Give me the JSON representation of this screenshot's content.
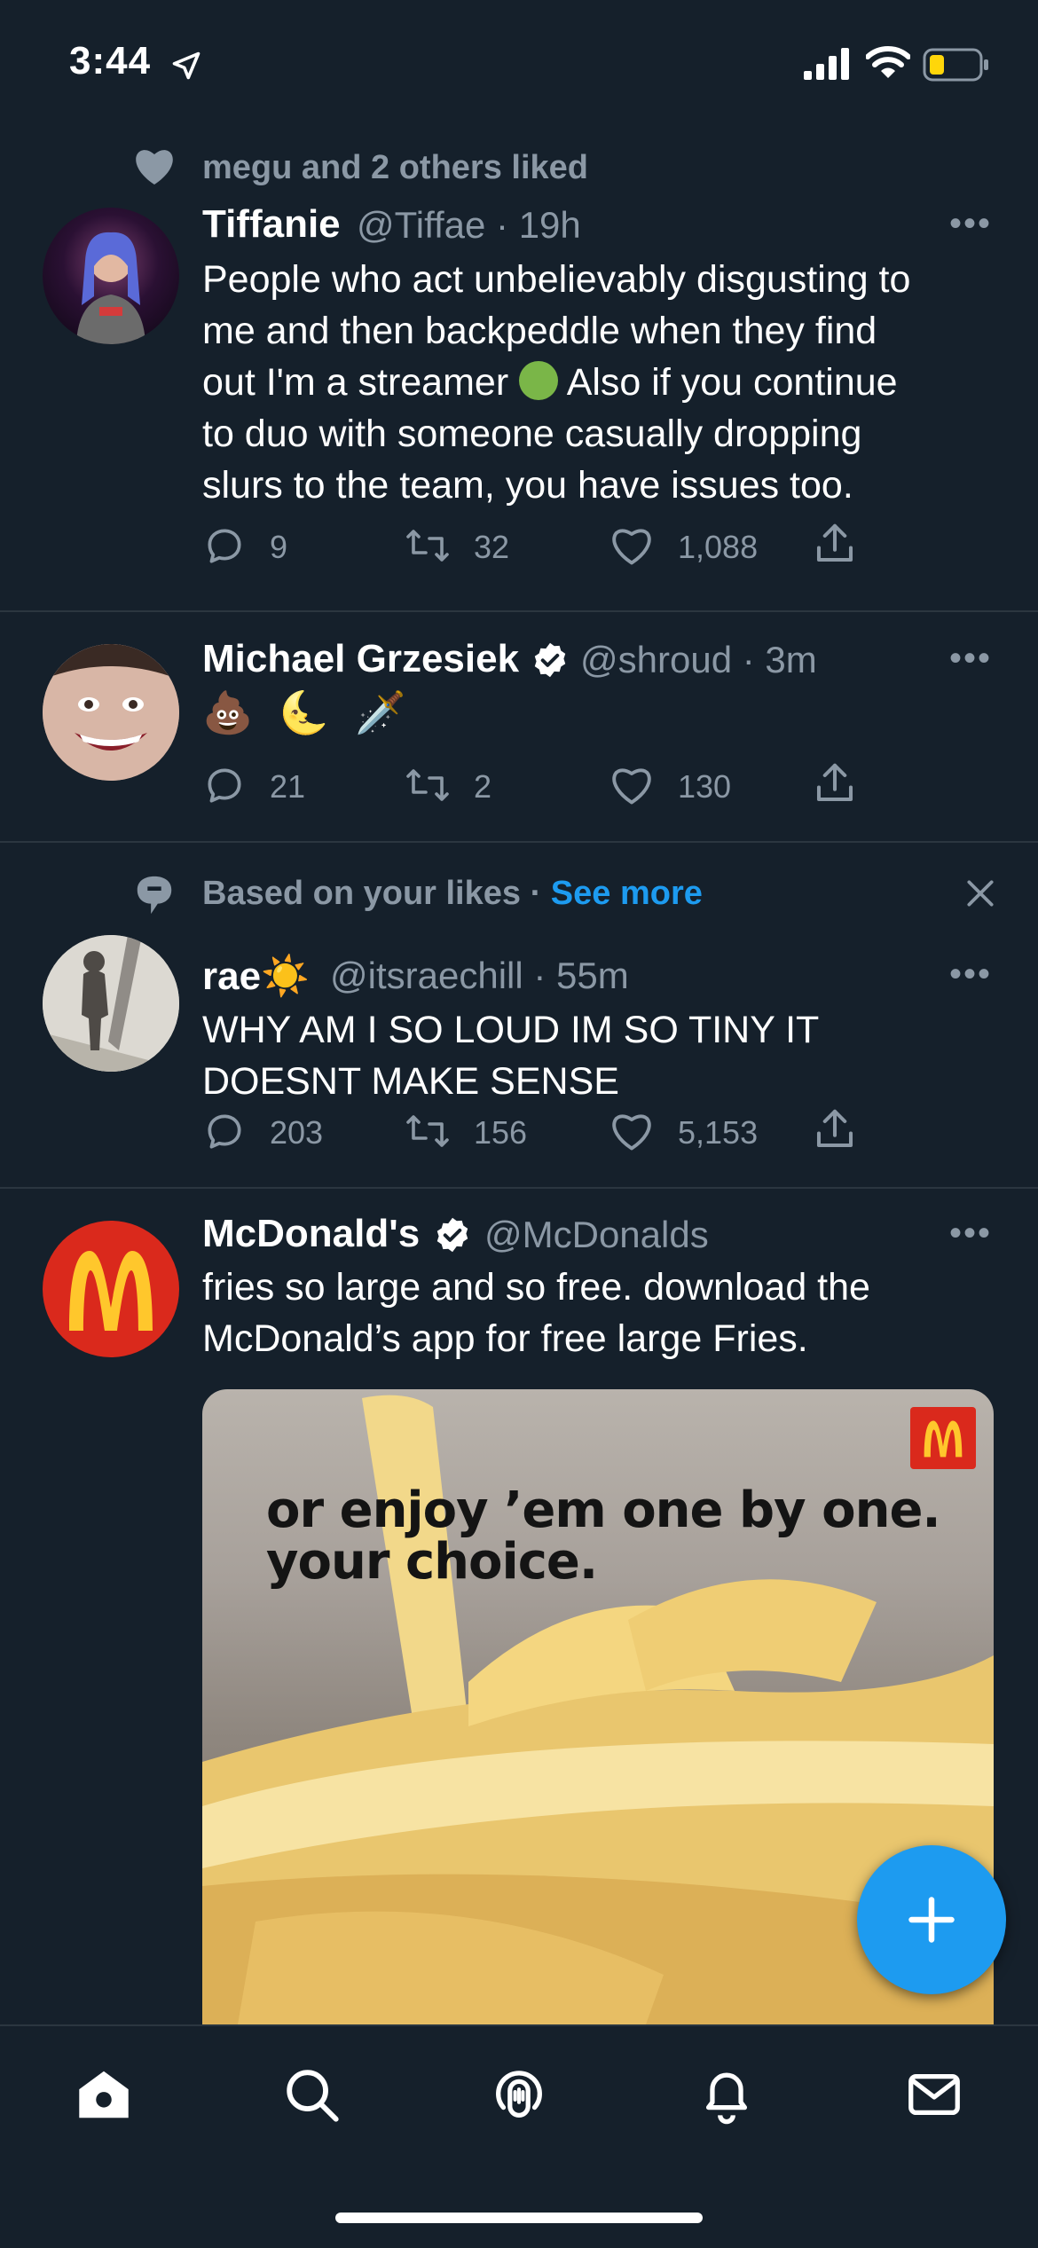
{
  "status_bar": {
    "time": "3:44"
  },
  "tweets": [
    {
      "social_context": "megu and 2 others liked",
      "name": "Tiffanie",
      "handle": "@Tiffae",
      "time": "19h",
      "text_lines": [
        "People who act unbelievably disgusting to",
        "me and then backpeddle when they find",
        "out I'm a streamer",
        "to duo with someone casually dropping",
        "slurs to the team, you have issues too."
      ],
      "text_line3_after": "Also if you continue",
      "replies": "9",
      "retweets": "32",
      "likes": "1,088"
    },
    {
      "name": "Michael Grzesiek",
      "handle": "@shroud",
      "time": "3m",
      "text": "💩 🌜 🗡️",
      "replies": "21",
      "retweets": "2",
      "likes": "130"
    },
    {
      "social_context": "Based on your likes",
      "see_more": "See more",
      "name": "rae",
      "name_emoji": "☀️",
      "handle": "@itsraechill",
      "time": "55m",
      "text_lines": [
        "WHY AM I SO LOUD IM SO TINY IT",
        "DOESNT MAKE SENSE"
      ],
      "replies": "203",
      "retweets": "156",
      "likes": "5,153"
    },
    {
      "name": "McDonald's",
      "handle": "@McDonalds",
      "text_lines": [
        "fries so large and so free. download the",
        "McDonald’s app for free large Fries."
      ],
      "media_caption_lines": [
        "or enjoy ’em one by one.",
        "your choice."
      ]
    }
  ],
  "colors": {
    "background": "#15202b",
    "accent": "#1d9bf0",
    "secondary_text": "#8b98a5",
    "separator": "#2b3640",
    "mcd_red": "#da291c",
    "mcd_yellow": "#ffc72c"
  },
  "icons": [
    "location-arrow-icon",
    "signal-icon",
    "wifi-icon",
    "battery-icon",
    "heart-icon",
    "reply-icon",
    "retweet-icon",
    "like-icon",
    "share-icon",
    "more-icon",
    "verified-icon",
    "close-icon",
    "compose-icon",
    "home-icon",
    "search-icon",
    "spaces-icon",
    "bell-icon",
    "mail-icon"
  ]
}
